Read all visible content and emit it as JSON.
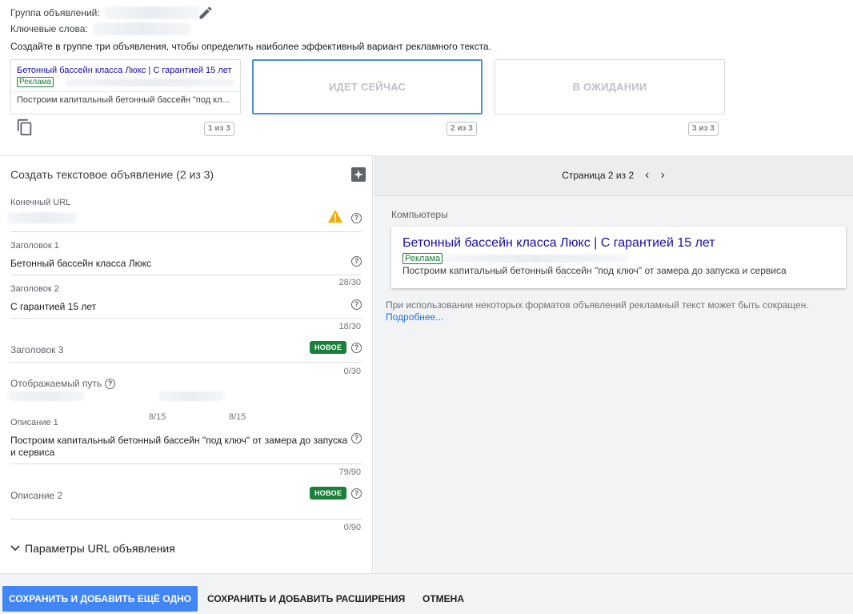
{
  "group": {
    "label": "Группа объявлений:",
    "keywords_label": "Ключевые слова:"
  },
  "intro": "Создайте в группе три объявления, чтобы определить наиболее эффективный вариант рекламного текста.",
  "cards": [
    {
      "headline": "Бетонный бассейн класса Люкс | С гарантией 15 лет",
      "badge": "Реклама",
      "description": "Построим капитальный бетонный бассейн \"под кл...",
      "counter": "1 из 3"
    },
    {
      "placeholder": "ИДЕТ СЕЙЧАС",
      "counter": "2 из 3"
    },
    {
      "placeholder": "В ОЖИДАНИИ",
      "counter": "3 из 3"
    }
  ],
  "editor": {
    "title": "Создать текстовое объявление (2 из 3)",
    "final_url_label": "Конечный URL",
    "headline1": {
      "label": "Заголовок 1",
      "value": "Бетонный бассейн класса Люкс",
      "count": "28/30"
    },
    "headline2": {
      "label": "Заголовок 2",
      "value": "С гарантией 15 лет",
      "count": "18/30"
    },
    "headline3": {
      "label": "Заголовок 3",
      "badge": "НОВОЕ",
      "count": "0/30"
    },
    "display_path": {
      "label": "Отображаемый путь",
      "count1": "8/15",
      "count2": "8/15"
    },
    "desc1": {
      "label": "Описание 1",
      "line1": "Построим капитальный бетонный бассейн \"под ключ\" от замера до запуска",
      "line2": "и сервиса",
      "count": "79/90"
    },
    "desc2": {
      "label": "Описание 2",
      "badge": "НОВОЕ",
      "count": "0/90"
    },
    "url_params": "Параметры URL объявления"
  },
  "preview": {
    "pager": "Страница 2 из 2",
    "device": "Компьютеры",
    "headline": "Бетонный бассейн класса Люкс | С гарантией 15 лет",
    "badge": "Реклама",
    "description": "Построим капитальный бетонный бассейн \"под ключ\" от замера до запуска и сервиса",
    "note": "При использовании некоторых форматов объявлений рекламный текст может быть сокращен.",
    "more_link": "Подробнее..."
  },
  "footer": {
    "save_add": "СОХРАНИТЬ И ДОБАВИТЬ ЕЩЁ ОДНО",
    "save_ext": "СОХРАНИТЬ И ДОБАВИТЬ РАСШИРЕНИЯ",
    "cancel": "ОТМЕНА"
  },
  "colors": {
    "primary": "#4285f4",
    "link": "#1a0dab",
    "badge_green": "#188038",
    "warning": "#f9ab00"
  }
}
